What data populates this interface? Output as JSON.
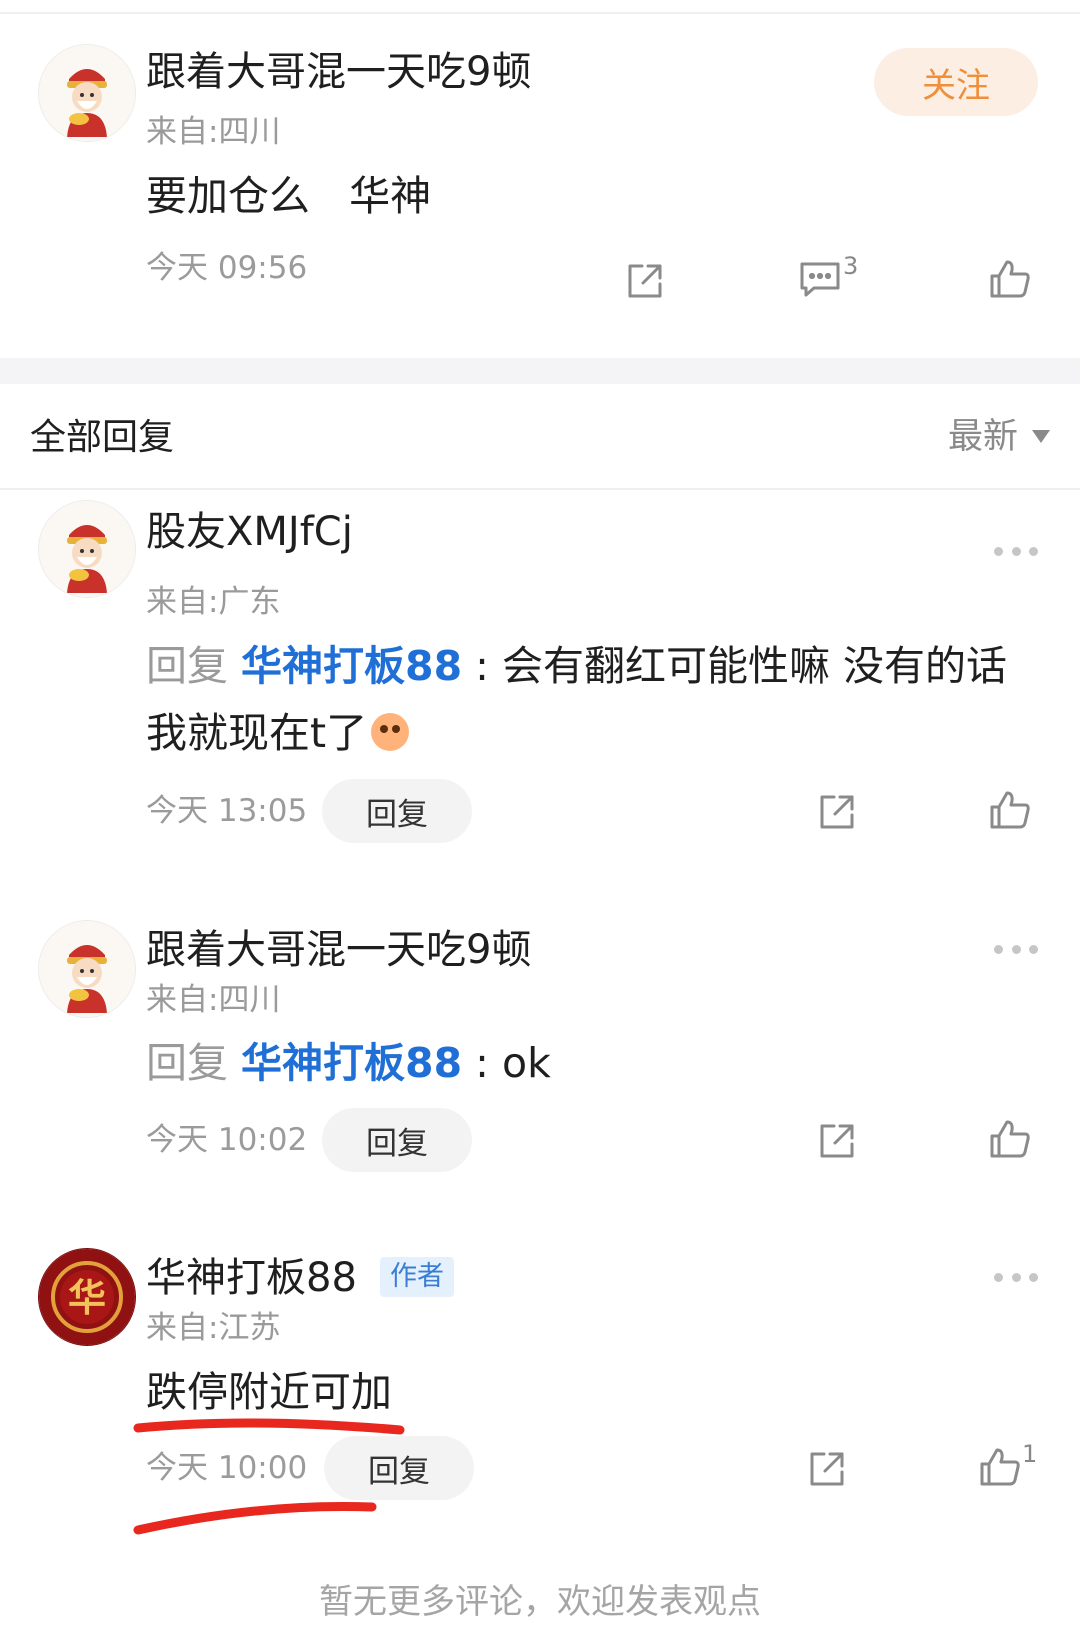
{
  "post": {
    "username": "跟着大哥混一天吃9顿",
    "region": "来自:四川",
    "content": "要加仓么   华神",
    "time": "今天 09:56",
    "follow_label": "关注",
    "comment_count": "3"
  },
  "replies_header": {
    "title": "全部回复",
    "sort_label": "最新"
  },
  "comments": [
    {
      "username": "股友XMJfCj",
      "region": "来自:广东",
      "reply_prefix": "回复",
      "mention": "华神打板88",
      "separator": " : ",
      "text_line1": "会有翻红可能性嘛 没有的话",
      "text_line2": "我就现在t了",
      "emoji_icon": "pleading-face-icon",
      "time": "今天 13:05",
      "reply_label": "回复"
    },
    {
      "username": "跟着大哥混一天吃9顿",
      "region": "来自:四川",
      "reply_prefix": "回复",
      "mention": "华神打板88",
      "separator": " : ",
      "text": "ok",
      "time": "今天 10:02",
      "reply_label": "回复"
    },
    {
      "username": "华神打板88",
      "badge": "作者",
      "region": "来自:江苏",
      "text": "跌停附近可加",
      "time": "今天 10:00",
      "reply_label": "回复",
      "like_count": "1",
      "avatar_glyph": "华"
    }
  ],
  "footer_text": "暂无更多评论，欢迎发表观点",
  "colors": {
    "mention": "#1f6fd6",
    "follow_bg": "#fdeee3",
    "follow_text": "#f08f3a",
    "annotation_red": "#e8281e",
    "author_avatar_bg": "#8f1111"
  }
}
